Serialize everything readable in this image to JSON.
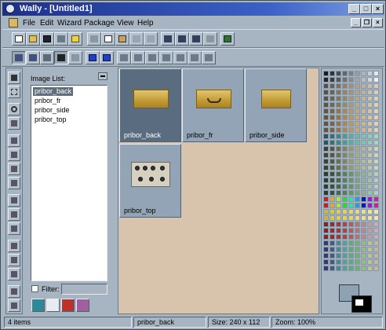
{
  "window": {
    "title": "Wally - [Untitled1]"
  },
  "menu": [
    "File",
    "Edit",
    "Wizard",
    "Package",
    "View",
    "Help"
  ],
  "image_list": {
    "label": "Image List:",
    "items": [
      "pribor_back",
      "pribor_fr",
      "pribor_side",
      "pribor_top"
    ],
    "selected_index": 0,
    "filter_label": "Filter:",
    "filter_value": ""
  },
  "thumbnails": [
    {
      "name": "pribor_back",
      "selected": true
    },
    {
      "name": "pribor_fr",
      "selected": false
    },
    {
      "name": "pribor_side",
      "selected": false
    },
    {
      "name": "pribor_top",
      "selected": false
    }
  ],
  "status": {
    "count": "4 items",
    "current": "pribor_back",
    "size": "Size: 240 x 112",
    "zoom": "Zoom: 100%"
  },
  "colors": {
    "selection": "#5c6e80",
    "canvas_bg": "#d8c3ac",
    "foreground": "#8ea2b4",
    "background": "#000000"
  }
}
